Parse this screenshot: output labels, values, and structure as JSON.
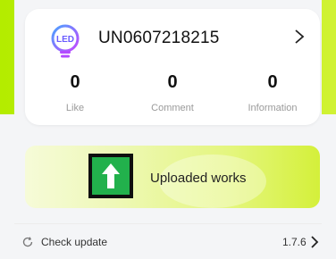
{
  "profile": {
    "username": "UN0607218215",
    "avatar_icon": "led-bulb-icon",
    "stats": [
      {
        "value": "0",
        "label": "Like"
      },
      {
        "value": "0",
        "label": "Comment"
      },
      {
        "value": "0",
        "label": "Information"
      }
    ]
  },
  "uploads": {
    "label": "Uploaded works",
    "icon": "upload-arrow-icon"
  },
  "settings": {
    "check_update_label": "Check update",
    "version": "1.7.6"
  },
  "colors": {
    "accent": "#c0ee00",
    "upload_icon_bg": "#22b14c"
  }
}
